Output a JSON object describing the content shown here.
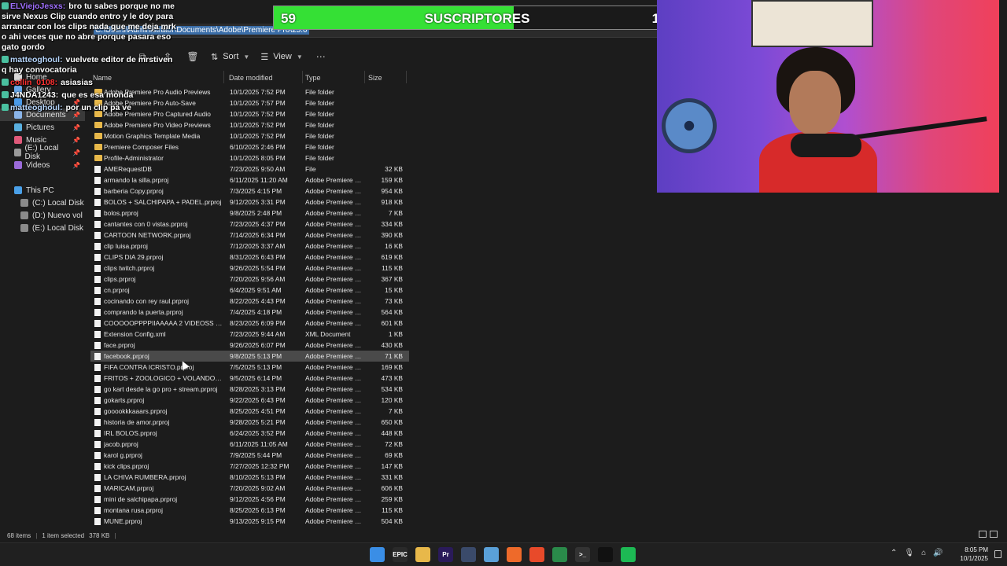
{
  "address": {
    "path": "C:\\Users\\Administrator\\Documents\\Adobe\\Premiere Pro\\25.0"
  },
  "toolbar": {
    "sort_label": "Sort",
    "view_label": "View",
    "more_label": "⋯",
    "icons": [
      "copy-icon",
      "share-icon",
      "delete-icon"
    ]
  },
  "nav": {
    "items": [
      {
        "label": "Home",
        "icon": "home-icon"
      },
      {
        "label": "Gallery",
        "icon": "gallery-icon"
      },
      {
        "label": "Desktop",
        "icon": "desktop-icon",
        "pinned": true
      },
      {
        "label": "Documents",
        "icon": "documents-icon",
        "pinned": true,
        "selected": true
      },
      {
        "label": "Pictures",
        "icon": "pictures-icon",
        "pinned": true
      },
      {
        "label": "Music",
        "icon": "music-icon",
        "pinned": true
      },
      {
        "label": "(E:) Local Disk",
        "icon": "disk-icon",
        "pinned": true
      },
      {
        "label": "Videos",
        "icon": "videos-icon",
        "pinned": true
      }
    ],
    "this_pc": {
      "label": "This PC",
      "drives": [
        "(C:) Local Disk",
        "(D:) Nuevo vol",
        "(E:) Local Disk"
      ]
    }
  },
  "columns": {
    "name": "Name",
    "date": "Date modified",
    "type": "Type",
    "size": "Size"
  },
  "files": [
    {
      "name": "Adobe Premiere Pro Audio Previews",
      "date": "10/1/2025 7:52 PM",
      "type": "File folder",
      "size": "",
      "kind": "folder"
    },
    {
      "name": "Adobe Premiere Pro Auto-Save",
      "date": "10/1/2025 7:57 PM",
      "type": "File folder",
      "size": "",
      "kind": "folder"
    },
    {
      "name": "Adobe Premiere Pro Captured Audio",
      "date": "10/1/2025 7:52 PM",
      "type": "File folder",
      "size": "",
      "kind": "folder"
    },
    {
      "name": "Adobe Premiere Pro Video Previews",
      "date": "10/1/2025 7:52 PM",
      "type": "File folder",
      "size": "",
      "kind": "folder"
    },
    {
      "name": "Motion Graphics Template Media",
      "date": "10/1/2025 7:52 PM",
      "type": "File folder",
      "size": "",
      "kind": "folder"
    },
    {
      "name": "Premiere Composer Files",
      "date": "6/10/2025 2:46 PM",
      "type": "File folder",
      "size": "",
      "kind": "folder"
    },
    {
      "name": "Profile-Administrator",
      "date": "10/1/2025 8:05 PM",
      "type": "File folder",
      "size": "",
      "kind": "folder"
    },
    {
      "name": "AMERequestDB",
      "date": "7/23/2025 9:50 AM",
      "type": "File",
      "size": "32 KB",
      "kind": "file"
    },
    {
      "name": "armando la silla.prproj",
      "date": "6/11/2025 11:20 AM",
      "type": "Adobe Premiere P...",
      "size": "159 KB",
      "kind": "file"
    },
    {
      "name": "barberia Copy.prproj",
      "date": "7/3/2025 4:15 PM",
      "type": "Adobe Premiere P...",
      "size": "954 KB",
      "kind": "file"
    },
    {
      "name": "BOLOS + SALCHIPAPA + PADEL.prproj",
      "date": "9/12/2025 3:31 PM",
      "type": "Adobe Premiere P...",
      "size": "918 KB",
      "kind": "file"
    },
    {
      "name": "bolos.prproj",
      "date": "9/8/2025 2:48 PM",
      "type": "Adobe Premiere P...",
      "size": "7 KB",
      "kind": "file"
    },
    {
      "name": "cantantes con 0 vistas.prproj",
      "date": "7/23/2025 4:37 PM",
      "type": "Adobe Premiere P...",
      "size": "334 KB",
      "kind": "file"
    },
    {
      "name": "CARTOON NETWORK.prproj",
      "date": "7/14/2025 6:34 PM",
      "type": "Adobe Premiere P...",
      "size": "390 KB",
      "kind": "file"
    },
    {
      "name": "clip luisa.prproj",
      "date": "7/12/2025 3:37 AM",
      "type": "Adobe Premiere P...",
      "size": "16 KB",
      "kind": "file"
    },
    {
      "name": "CLIPS DIA 29.prproj",
      "date": "8/31/2025 6:43 PM",
      "type": "Adobe Premiere P...",
      "size": "619 KB",
      "kind": "file"
    },
    {
      "name": "clips twitch.prproj",
      "date": "9/26/2025 5:54 PM",
      "type": "Adobe Premiere P...",
      "size": "115 KB",
      "kind": "file"
    },
    {
      "name": "clips.prproj",
      "date": "7/20/2025 9:56 AM",
      "type": "Adobe Premiere P...",
      "size": "367 KB",
      "kind": "file"
    },
    {
      "name": "cn.prproj",
      "date": "6/4/2025 9:51 AM",
      "type": "Adobe Premiere P...",
      "size": "15 KB",
      "kind": "file"
    },
    {
      "name": "cocinando con rey raul.prproj",
      "date": "8/22/2025 4:43 PM",
      "type": "Adobe Premiere P...",
      "size": "73 KB",
      "kind": "file"
    },
    {
      "name": "comprando la puerta.prproj",
      "date": "7/4/2025 4:18 PM",
      "type": "Adobe Premiere P...",
      "size": "564 KB",
      "kind": "file"
    },
    {
      "name": "COOOOOPPPPIIAAAAA  2 VIDEOSS BOL...",
      "date": "8/23/2025 6:09 PM",
      "type": "Adobe Premiere P...",
      "size": "601 KB",
      "kind": "file"
    },
    {
      "name": "Extension Config.xml",
      "date": "7/23/2025 9:44 AM",
      "type": "XML Document",
      "size": "1 KB",
      "kind": "file"
    },
    {
      "name": "face.prproj",
      "date": "9/26/2025 6:07 PM",
      "type": "Adobe Premiere P...",
      "size": "430 KB",
      "kind": "file"
    },
    {
      "name": "facebook.prproj",
      "date": "9/8/2025 5:13 PM",
      "type": "Adobe Premiere P...",
      "size": "71 KB",
      "kind": "file",
      "selected": true
    },
    {
      "name": "FIFA CONTRA ICRISTO.prproj",
      "date": "7/5/2025 5:13 PM",
      "type": "Adobe Premiere P...",
      "size": "169 KB",
      "kind": "file"
    },
    {
      "name": "FRITOS + ZOOLOGICO + VOLANDO CO...",
      "date": "9/5/2025 6:14 PM",
      "type": "Adobe Premiere P...",
      "size": "473 KB",
      "kind": "file"
    },
    {
      "name": "go kart desde la go pro + stream.prproj",
      "date": "8/28/2025 3:13 PM",
      "type": "Adobe Premiere P...",
      "size": "534 KB",
      "kind": "file"
    },
    {
      "name": "gokarts.prproj",
      "date": "9/22/2025 6:43 PM",
      "type": "Adobe Premiere P...",
      "size": "120 KB",
      "kind": "file"
    },
    {
      "name": "gooookkkaaars.prproj",
      "date": "8/25/2025 4:51 PM",
      "type": "Adobe Premiere P...",
      "size": "7 KB",
      "kind": "file"
    },
    {
      "name": "historia de amor.prproj",
      "date": "9/28/2025 5:21 PM",
      "type": "Adobe Premiere P...",
      "size": "650 KB",
      "kind": "file"
    },
    {
      "name": "IRL BOLOS.prproj",
      "date": "6/24/2025 3:52 PM",
      "type": "Adobe Premiere P...",
      "size": "448 KB",
      "kind": "file"
    },
    {
      "name": "jacob.prproj",
      "date": "6/11/2025 11:05 AM",
      "type": "Adobe Premiere P...",
      "size": "72 KB",
      "kind": "file"
    },
    {
      "name": "karol g.prproj",
      "date": "7/9/2025 5:44 PM",
      "type": "Adobe Premiere P...",
      "size": "69 KB",
      "kind": "file"
    },
    {
      "name": "kick clips.prproj",
      "date": "7/27/2025 12:32 PM",
      "type": "Adobe Premiere P...",
      "size": "147 KB",
      "kind": "file"
    },
    {
      "name": "LA CHIVA RUMBERA.prproj",
      "date": "8/10/2025 5:13 PM",
      "type": "Adobe Premiere P...",
      "size": "331 KB",
      "kind": "file"
    },
    {
      "name": "MARICAM.prproj",
      "date": "7/20/2025 9:02 AM",
      "type": "Adobe Premiere P...",
      "size": "606 KB",
      "kind": "file"
    },
    {
      "name": "mini de salchipapa.prproj",
      "date": "9/12/2025 4:56 PM",
      "type": "Adobe Premiere P...",
      "size": "259 KB",
      "kind": "file"
    },
    {
      "name": "montana rusa.prproj",
      "date": "8/25/2025 6:13 PM",
      "type": "Adobe Premiere P...",
      "size": "115 KB",
      "kind": "file"
    },
    {
      "name": "MUNE.prproj",
      "date": "9/13/2025 9:15 PM",
      "type": "Adobe Premiere P...",
      "size": "504 KB",
      "kind": "file"
    }
  ],
  "status": {
    "count": "68 items",
    "selection": "1 item selected",
    "size": "378 KB"
  },
  "chat": [
    {
      "user": "ELViejoJesxs:",
      "text": "bro tu sabes porque no me sirve Nexus Clip cuando entro y le doy para arrancar con los clips nada que me deja mrk o ahi veces que no abre porque pasara eso gato gordo",
      "color": "#a070ff"
    },
    {
      "user": "matteoghoul:",
      "text": "vuelvete editor de mrstiven q hay convocatoria",
      "color": "#b8d8ff"
    },
    {
      "user": "collin_0108:",
      "text": "asiasias",
      "color": "#ff3030"
    },
    {
      "user": "J4NDA1243:",
      "text": "que es esa monda",
      "color": "#ffffff"
    },
    {
      "user": "matteoghoul:",
      "text": "por un clip pa ve",
      "color": "#b8d8ff"
    }
  ],
  "goal": {
    "current": "59",
    "label": "SUSCRIPTORES",
    "target": "100",
    "progress": 0.59,
    "color": "#35e035"
  },
  "taskbar": {
    "apps": [
      {
        "name": "start-icon",
        "glyph": "",
        "color": "#3a8ee6"
      },
      {
        "name": "epic-games-icon",
        "glyph": "EPIC",
        "color": "#2a2a2a"
      },
      {
        "name": "file-explorer-icon",
        "glyph": "",
        "color": "#e8b84a"
      },
      {
        "name": "premiere-pro-icon",
        "glyph": "Pr",
        "color": "#2a1a5a"
      },
      {
        "name": "steam-icon",
        "glyph": "",
        "color": "#3a4a6a"
      },
      {
        "name": "notepad-icon",
        "glyph": "",
        "color": "#5aa0d8"
      },
      {
        "name": "obs-icon",
        "glyph": "",
        "color": "#ee6a2a"
      },
      {
        "name": "brave-icon",
        "glyph": "",
        "color": "#e84a2a"
      },
      {
        "name": "chrome-icon",
        "glyph": "",
        "color": "#2a8a4a"
      },
      {
        "name": "terminal-icon",
        "glyph": ">_",
        "color": "#333333"
      },
      {
        "name": "capcut-icon",
        "glyph": "",
        "color": "#111111"
      },
      {
        "name": "spotify-icon",
        "glyph": "",
        "color": "#1db954"
      }
    ],
    "time": "8:05 PM",
    "date": "10/1/2025"
  }
}
